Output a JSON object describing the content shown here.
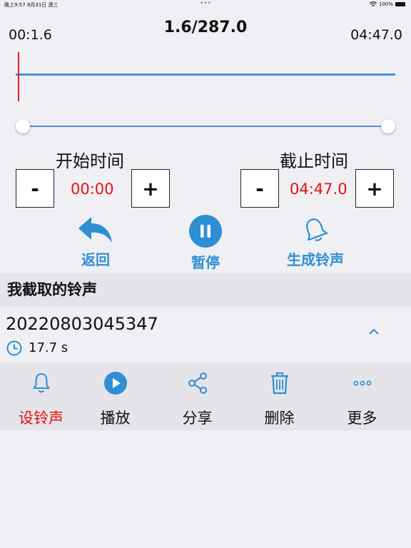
{
  "status_bar": {
    "time_date": "晚上9:57  8月31日 週三",
    "battery": "100%",
    "dots": "•••"
  },
  "player": {
    "current_time": "00:1.6",
    "position_total": "1.6/287.0",
    "end_time": "04:47.0"
  },
  "trim": {
    "start_label": "开始时间",
    "start_value": "00:00",
    "end_label": "截止时间",
    "end_value": "04:47.0",
    "minus_label": "-",
    "plus_label": "+"
  },
  "actions": {
    "back": "返回",
    "pause": "暂停",
    "generate": "生成铃声"
  },
  "section": {
    "title": "我截取的铃声"
  },
  "ringtone": {
    "name": "20220803045347",
    "duration": "17.7 s"
  },
  "toolbar": {
    "set_ringtone": "设铃声",
    "play": "播放",
    "share": "分享",
    "delete": "删除",
    "more": "更多"
  },
  "colors": {
    "accent": "#2f8fd4",
    "highlight": "#e81010",
    "waveform": "#4a90e2"
  }
}
